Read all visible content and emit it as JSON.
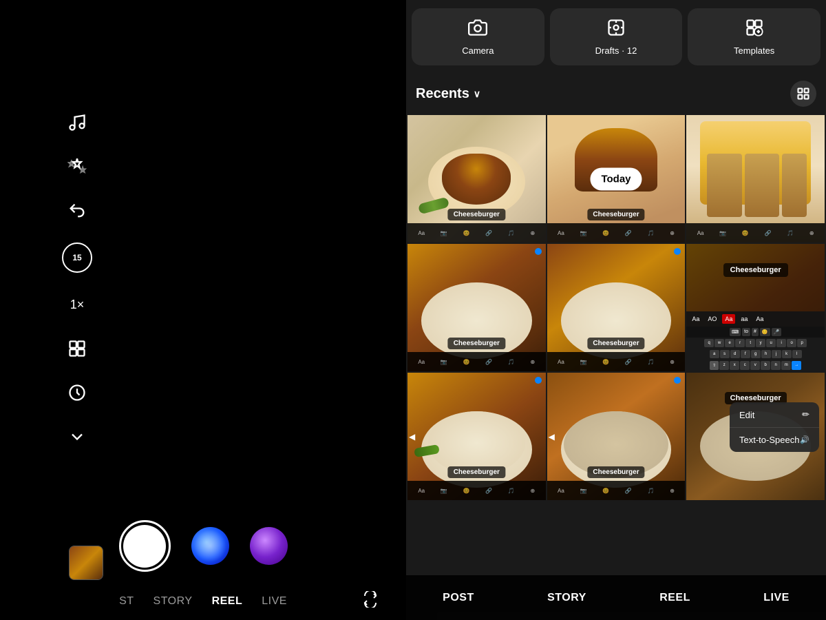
{
  "camera": {
    "panel_bg": "#000000",
    "icons": {
      "music": "♫",
      "effects": "✦",
      "undo": "↩",
      "timer_label": "15",
      "speed_label": "1×",
      "layout": "⊞",
      "clock": "⏱",
      "chevron_down": "∨",
      "flip": "⟳"
    },
    "nav_items": [
      "ST",
      "STORY",
      "REEL",
      "LIVE"
    ],
    "active_nav": "REEL"
  },
  "gallery": {
    "top_buttons": [
      {
        "id": "camera",
        "icon": "📷",
        "label": "Camera"
      },
      {
        "id": "drafts",
        "icon": "⊕",
        "label": "Drafts · 12"
      },
      {
        "id": "templates",
        "icon": "⊞",
        "label": "Templates"
      }
    ],
    "recents_label": "Recents",
    "today_label": "Today",
    "cheeseburger_label": "Cheeseburger",
    "nav_items": [
      "POST",
      "STORY",
      "REEL",
      "LIVE"
    ],
    "active_nav": "REEL",
    "context_menu": [
      {
        "label": "Edit",
        "icon": "✏"
      },
      {
        "label": "Text-to-Speech",
        "icon": "🔊"
      }
    ],
    "text_styles": [
      "Aa",
      "AO",
      "Aa",
      "aa",
      "Aa"
    ],
    "keyboard_rows": [
      [
        "q",
        "w",
        "e",
        "r",
        "t",
        "y",
        "u",
        "i",
        "o",
        "p"
      ],
      [
        "a",
        "s",
        "d",
        "f",
        "g",
        "h",
        "j",
        "k",
        "l"
      ],
      [
        "z",
        "x",
        "c",
        "v",
        "b",
        "n",
        "m"
      ]
    ],
    "keyboard_special_row": [
      "⌨",
      "to",
      "#",
      "😊",
      "🎤"
    ]
  }
}
